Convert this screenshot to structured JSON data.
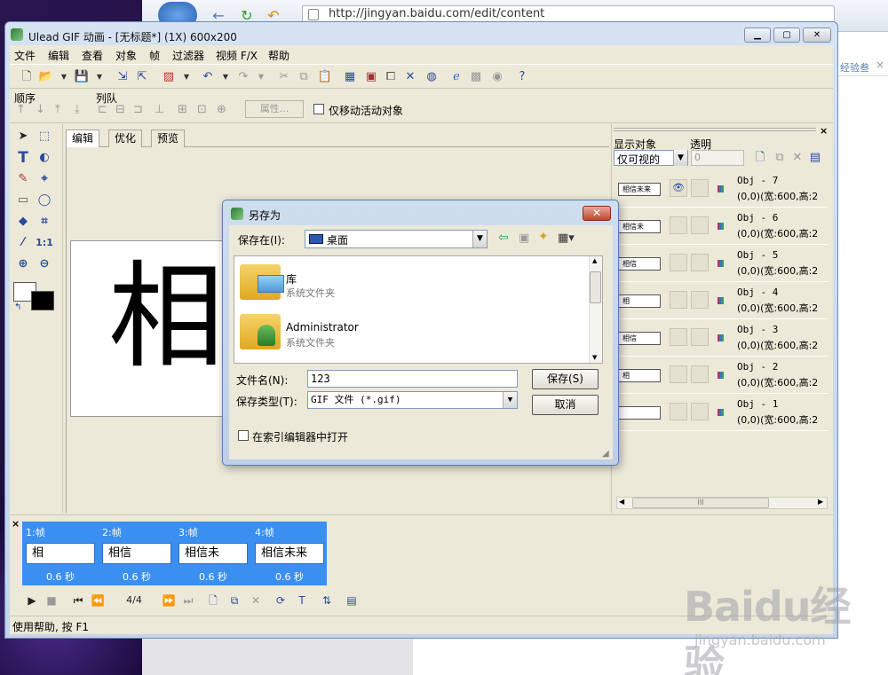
{
  "browser": {
    "url": "http://jingyan.baidu.com/edit/content",
    "side_text": "经验叁"
  },
  "window": {
    "title": "Ulead GIF 动画 - [无标题*] (1X) 600x200",
    "menu": [
      "文件",
      "编辑",
      "查看",
      "对象",
      "帧",
      "过滤器",
      "视频 F/X",
      "帮助"
    ]
  },
  "order_bar": {
    "order_label": "顺序",
    "queue_label": "列队",
    "props_label": "属性...",
    "move_only_label": "仅移动活动对象"
  },
  "tabs": [
    "编辑",
    "优化",
    "预览"
  ],
  "canvas": {
    "char": "相"
  },
  "right_panel": {
    "show_label": "显示对象",
    "alpha_label": "透明",
    "show_value": "仅可视的",
    "alpha_value": "0",
    "objects": [
      {
        "name": "Obj - 7",
        "pos": "(0,0)(宽:600,高:2",
        "thumb": "相信未来"
      },
      {
        "name": "Obj - 6",
        "pos": "(0,0)(宽:600,高:2",
        "thumb": "相信未"
      },
      {
        "name": "Obj - 5",
        "pos": "(0,0)(宽:600,高:2",
        "thumb": "相信"
      },
      {
        "name": "Obj - 4",
        "pos": "(0,0)(宽:600,高:2",
        "thumb": "相"
      },
      {
        "name": "Obj - 3",
        "pos": "(0,0)(宽:600,高:2",
        "thumb": "相信"
      },
      {
        "name": "Obj - 2",
        "pos": "(0,0)(宽:600,高:2",
        "thumb": "相"
      },
      {
        "name": "Obj - 1",
        "pos": "(0,0)(宽:600,高:2",
        "thumb": ""
      }
    ],
    "scroll_grip": "III"
  },
  "frames": [
    {
      "label": "1:帧",
      "thumb": "相",
      "delay": "0.6 秒"
    },
    {
      "label": "2:帧",
      "thumb": "相信",
      "delay": "0.6 秒"
    },
    {
      "label": "3:帧",
      "thumb": "相信未",
      "delay": "0.6 秒"
    },
    {
      "label": "4:帧",
      "thumb": "相信未来",
      "delay": "0.6 秒"
    }
  ],
  "playbar": {
    "counter": "4/4"
  },
  "status": "使用帮助, 按 F1",
  "dialog": {
    "title": "另存为",
    "save_in_label": "保存在(I):",
    "save_in_value": "桌面",
    "items": [
      {
        "name": "库",
        "sub": "系统文件夹"
      },
      {
        "name": "Administrator",
        "sub": "系统文件夹"
      }
    ],
    "filename_label": "文件名(N):",
    "filename_value": "123",
    "filetype_label": "保存类型(T):",
    "filetype_value": "GIF 文件 (*.gif)",
    "save_button": "保存(S)",
    "cancel_button": "取消",
    "open_in_editor_label": "在索引编辑器中打开"
  },
  "watermark": {
    "logo": "Baidu经验",
    "url": "jingyan.baidu.com"
  }
}
